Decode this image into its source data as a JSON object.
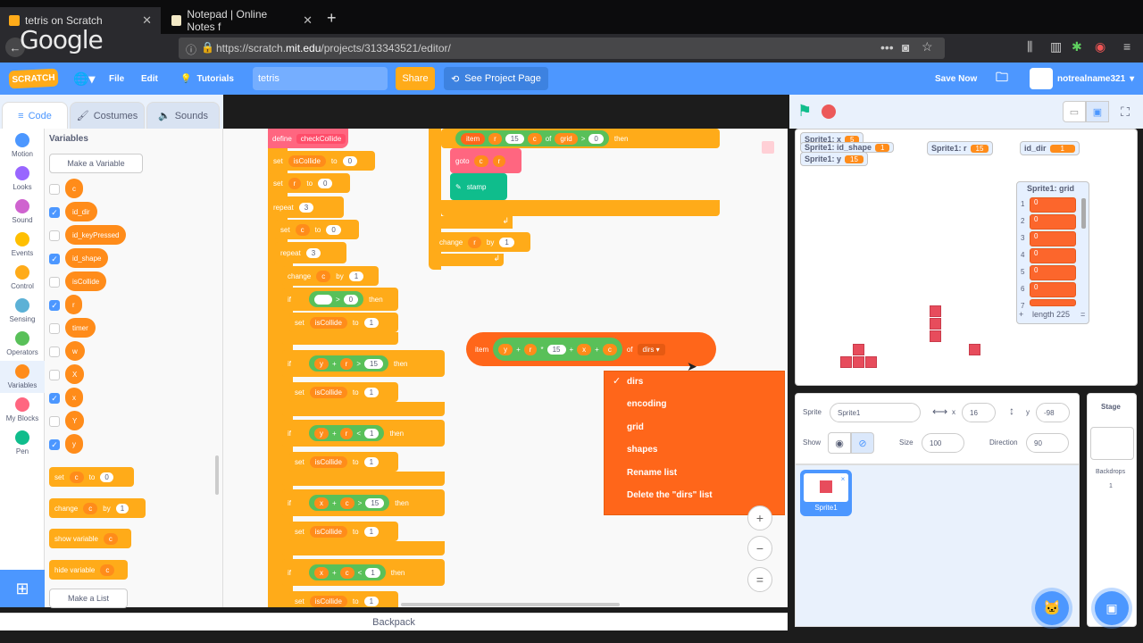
{
  "browser": {
    "tabs": [
      {
        "title": "tetris on Scratch"
      },
      {
        "title": "Notepad | Online Notes f"
      }
    ],
    "new_tab": "+",
    "overlay_logo": "Google",
    "url_host": "https://scratch.",
    "url_domain": "mit.edu",
    "url_path": "/projects/313343521/editor/"
  },
  "menu": {
    "logo": "SCRATCH",
    "file": "File",
    "edit": "Edit",
    "tutorials": "Tutorials",
    "project_title": "tetris",
    "share": "Share",
    "see_project": "See Project Page",
    "save_now": "Save Now",
    "username": "notrealname321"
  },
  "editor_tabs": {
    "code": "Code",
    "costumes": "Costumes",
    "sounds": "Sounds"
  },
  "categories": [
    {
      "label": "Motion",
      "color": "#4c97ff"
    },
    {
      "label": "Looks",
      "color": "#9966ff"
    },
    {
      "label": "Sound",
      "color": "#cf63cf"
    },
    {
      "label": "Events",
      "color": "#ffbf00"
    },
    {
      "label": "Control",
      "color": "#ffab19"
    },
    {
      "label": "Sensing",
      "color": "#5cb1d6"
    },
    {
      "label": "Operators",
      "color": "#59c059"
    },
    {
      "label": "Variables",
      "color": "#ff8c1a"
    },
    {
      "label": "My Blocks",
      "color": "#ff6680"
    },
    {
      "label": "Pen",
      "color": "#0fbd8c"
    }
  ],
  "palette": {
    "heading": "Variables",
    "make_variable": "Make a Variable",
    "make_list": "Make a List",
    "variables": [
      {
        "name": "c",
        "checked": false
      },
      {
        "name": "id_dir",
        "checked": true
      },
      {
        "name": "id_keyPressed",
        "checked": false
      },
      {
        "name": "id_shape",
        "checked": true
      },
      {
        "name": "isCollide",
        "checked": false
      },
      {
        "name": "r",
        "checked": true
      },
      {
        "name": "timer",
        "checked": false
      },
      {
        "name": "w",
        "checked": false
      },
      {
        "name": "X",
        "checked": false
      },
      {
        "name": "x",
        "checked": true
      },
      {
        "name": "Y",
        "checked": false
      },
      {
        "name": "y",
        "checked": true
      }
    ],
    "blocks": [
      {
        "label": "set",
        "var": "c",
        "word": "to",
        "value": "0"
      },
      {
        "label": "change",
        "var": "c",
        "word": "by",
        "value": "1"
      },
      {
        "label": "show variable",
        "var": "c"
      },
      {
        "label": "hide variable",
        "var": "c"
      }
    ]
  },
  "script_left": {
    "define": "define",
    "define_name": "checkCollide",
    "set1": {
      "label": "set",
      "var": "isCollide",
      "word": "to",
      "value": "0"
    },
    "set2": {
      "label": "set",
      "var": "r",
      "word": "to",
      "value": "0"
    },
    "repeat1": {
      "label": "repeat",
      "value": "3"
    },
    "set3": {
      "label": "set",
      "var": "c",
      "word": "to",
      "value": "0"
    },
    "repeat2": {
      "label": "repeat",
      "value": "3"
    },
    "change1": {
      "label": "change",
      "var": "c",
      "word": "by",
      "value": "1"
    },
    "if_word": "if",
    "then_word": "then",
    "cond1_right": "0",
    "cond1_op": ">",
    "set_isCollide": "isCollide",
    "set_value": "1",
    "cond2": {
      "a": "y",
      "op1": "+",
      "b": "r",
      "op2": ">",
      "c": "15"
    },
    "cond3": {
      "a": "y",
      "op1": "+",
      "b": "r",
      "op2": "<",
      "c": "1"
    },
    "cond4": {
      "a": "x",
      "op1": "+",
      "b": "c",
      "op2": ">",
      "c": "15"
    },
    "cond5": {
      "a": "x",
      "op1": "+",
      "b": "c",
      "op2": "<",
      "c": "1"
    }
  },
  "script_right": {
    "item": "item",
    "r": "r",
    "n15": "15",
    "c": "c",
    "of": "of",
    "grid": "grid",
    "gt": ">",
    "zero": "0",
    "then": "then",
    "goto": "goto",
    "stamp": "stamp",
    "change": "change",
    "by": "by",
    "one": "1"
  },
  "floating_reporter": {
    "item": "item",
    "a": "y",
    "plus1": "+",
    "b": "r",
    "times": "*",
    "n": "15",
    "plus2": "+",
    "c": "x",
    "plus3": "+",
    "d": "c",
    "of": "of",
    "list": "dirs"
  },
  "dropdown": {
    "items": [
      "dirs",
      "encoding",
      "grid",
      "shapes",
      "Rename list",
      "Delete the \"dirs\" list"
    ],
    "checkmark": "✓"
  },
  "zoom": {
    "in": "+",
    "out": "−",
    "reset": "="
  },
  "backpack": "Backpack",
  "stage": {
    "monitors": [
      {
        "label": "Sprite1: x",
        "value": "5"
      },
      {
        "label": "Sprite1: id_shape",
        "value": "1"
      },
      {
        "label": "Sprite1: y",
        "value": "15"
      },
      {
        "label": "Sprite1: r",
        "value": "15"
      },
      {
        "label": "id_dir",
        "value": "1"
      }
    ],
    "list_title": "Sprite1: grid",
    "list_rows": [
      {
        "i": "1",
        "v": "0"
      },
      {
        "i": "2",
        "v": "0"
      },
      {
        "i": "3",
        "v": "0"
      },
      {
        "i": "4",
        "v": "0"
      },
      {
        "i": "5",
        "v": "0"
      },
      {
        "i": "6",
        "v": "0"
      },
      {
        "i": "7",
        "v": ""
      }
    ],
    "list_add": "+",
    "list_length": "length 225",
    "list_eq": "="
  },
  "sprite_info": {
    "sprite_label": "Sprite",
    "sprite_name": "Sprite1",
    "x_label": "x",
    "x": "16",
    "y_label": "y",
    "y": "-98",
    "show_label": "Show",
    "size_label": "Size",
    "size": "100",
    "direction_label": "Direction",
    "direction": "90",
    "thumb_name": "Sprite1"
  },
  "stage_pane": {
    "title": "Stage",
    "backdrops_label": "Backdrops",
    "backdrops_count": "1"
  }
}
